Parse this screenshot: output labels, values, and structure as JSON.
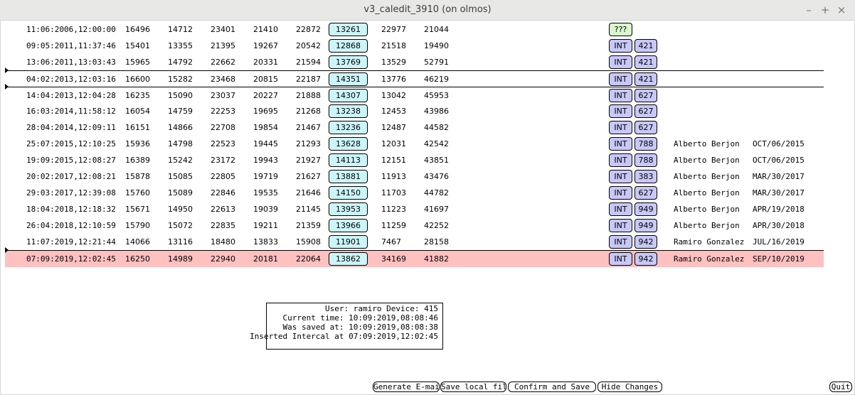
{
  "window": {
    "title": "v3_caledit_3910 (on olmos)",
    "minimize": "–",
    "maximize": "+",
    "close": "×"
  },
  "rows": [
    {
      "date": "11:06:2006,12:00:00",
      "v1": "16496",
      "v2": "14712",
      "v3": "23401",
      "v4": "21410",
      "v5": "22872",
      "box": "13261",
      "v6": "22977",
      "v7": "21044",
      "tag": "???",
      "dev": "",
      "name": "",
      "sdate": ""
    },
    {
      "date": "09:05:2011,11:37:46",
      "v1": "15401",
      "v2": "13355",
      "v3": "21395",
      "v4": "19267",
      "v5": "20542",
      "box": "12868",
      "v6": "21518",
      "v7": "19490",
      "tag": "INT",
      "dev": "421",
      "name": "",
      "sdate": ""
    },
    {
      "date": "13:06:2011,13:03:43",
      "v1": "15965",
      "v2": "14792",
      "v3": "22662",
      "v4": "20331",
      "v5": "21594",
      "box": "13769",
      "v6": "13529",
      "v7": "52791",
      "tag": "INT",
      "dev": "421",
      "name": "",
      "sdate": ""
    },
    {
      "date": "04:02:2013,12:03:16",
      "v1": "16600",
      "v2": "15282",
      "v3": "23468",
      "v4": "20815",
      "v5": "22187",
      "box": "14351",
      "v6": "13776",
      "v7": "46219",
      "tag": "INT",
      "dev": "421",
      "name": "",
      "sdate": ""
    },
    {
      "date": "14:04:2013,12:04:28",
      "v1": "16235",
      "v2": "15090",
      "v3": "23037",
      "v4": "20227",
      "v5": "21888",
      "box": "14307",
      "v6": "13042",
      "v7": "45953",
      "tag": "INT",
      "dev": "627",
      "name": "",
      "sdate": ""
    },
    {
      "date": "16:03:2014,11:58:12",
      "v1": "16054",
      "v2": "14759",
      "v3": "22253",
      "v4": "19695",
      "v5": "21268",
      "box": "13238",
      "v6": "12453",
      "v7": "43986",
      "tag": "INT",
      "dev": "627",
      "name": "",
      "sdate": ""
    },
    {
      "date": "28:04:2014,12:09:11",
      "v1": "16151",
      "v2": "14866",
      "v3": "22708",
      "v4": "19854",
      "v5": "21467",
      "box": "13236",
      "v6": "12487",
      "v7": "44582",
      "tag": "INT",
      "dev": "627",
      "name": "",
      "sdate": ""
    },
    {
      "date": "25:07:2015,12:10:25",
      "v1": "15936",
      "v2": "14798",
      "v3": "22523",
      "v4": "19445",
      "v5": "21293",
      "box": "13628",
      "v6": "12031",
      "v7": "42542",
      "tag": "INT",
      "dev": "788",
      "name": "Alberto Berjon",
      "sdate": "OCT/06/2015"
    },
    {
      "date": "19:09:2015,12:08:27",
      "v1": "16389",
      "v2": "15242",
      "v3": "23172",
      "v4": "19943",
      "v5": "21927",
      "box": "14113",
      "v6": "12151",
      "v7": "43851",
      "tag": "INT",
      "dev": "788",
      "name": "Alberto Berjon",
      "sdate": "OCT/06/2015"
    },
    {
      "date": "20:02:2017,12:08:21",
      "v1": "15878",
      "v2": "15085",
      "v3": "22805",
      "v4": "19719",
      "v5": "21627",
      "box": "13881",
      "v6": "11913",
      "v7": "43476",
      "tag": "INT",
      "dev": "383",
      "name": "Alberto Berjon",
      "sdate": "MAR/30/2017"
    },
    {
      "date": "29:03:2017,12:39:08",
      "v1": "15760",
      "v2": "15089",
      "v3": "22846",
      "v4": "19535",
      "v5": "21646",
      "box": "14150",
      "v6": "11703",
      "v7": "44782",
      "tag": "INT",
      "dev": "627",
      "name": "Alberto Berjon",
      "sdate": "MAR/30/2017"
    },
    {
      "date": "18:04:2018,12:18:32",
      "v1": "15671",
      "v2": "14950",
      "v3": "22613",
      "v4": "19039",
      "v5": "21145",
      "box": "13953",
      "v6": "11223",
      "v7": "41697",
      "tag": "INT",
      "dev": "949",
      "name": "Alberto Berjon",
      "sdate": "APR/19/2018"
    },
    {
      "date": "26:04:2018,12:10:59",
      "v1": "15790",
      "v2": "15072",
      "v3": "22835",
      "v4": "19211",
      "v5": "21359",
      "box": "13966",
      "v6": "11259",
      "v7": "42252",
      "tag": "INT",
      "dev": "949",
      "name": "Alberto Berjon",
      "sdate": "APR/30/2018"
    },
    {
      "date": "11:07:2019,12:21:44",
      "v1": "14066",
      "v2": "13116",
      "v3": "18480",
      "v4": "13833",
      "v5": "15908",
      "box": "11901",
      "v6": "7467",
      "v7": "28158",
      "tag": "INT",
      "dev": "942",
      "name": "Ramiro Gonzalez",
      "sdate": "JUL/16/2019"
    },
    {
      "date": "07:09:2019,12:02:45",
      "v1": "16250",
      "v2": "14989",
      "v3": "22940",
      "v4": "20181",
      "v5": "22064",
      "box": "13862",
      "v6": "34169",
      "v7": "41882",
      "tag": "INT",
      "dev": "942",
      "name": "Ramiro Gonzalez",
      "sdate": "SEP/10/2019"
    }
  ],
  "info": {
    "line1": "User: ramiro Device: 415",
    "line2": "Current time: 10:09:2019,08:08:46",
    "line3": "Was saved at: 10:09:2019,08:08:38",
    "line4": "Inserted Intercal at 07:09:2019,12:02:45"
  },
  "buttons": {
    "email": "Generate E-mail",
    "save_local": "Save local file",
    "confirm": "Confirm and Save",
    "hide": "Hide Changes",
    "quit": "Quit"
  }
}
